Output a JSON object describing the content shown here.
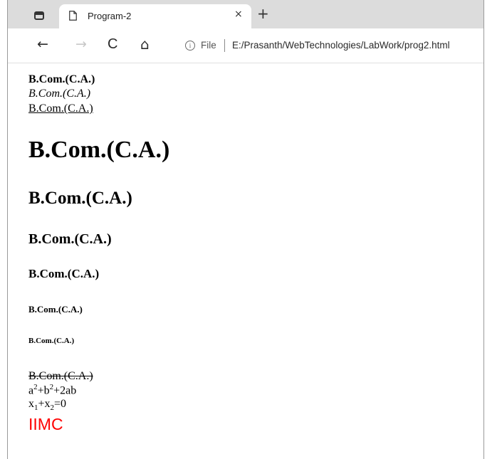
{
  "browser": {
    "tab_title": "Program-2",
    "tab_close": "×",
    "new_tab": "+",
    "back": "←",
    "forward": "→",
    "reload": "C",
    "home": "⌂",
    "info": "i",
    "file_label": "File",
    "url": "E:/Prasanth/WebTechnologies/LabWork/prog2.html"
  },
  "content": {
    "bold_text": "B.Com.(C.A.)",
    "italic_text": "B.Com.(C.A.)",
    "underline_text": "B.Com.(C.A.)",
    "h1": "B.Com.(C.A.)",
    "h2": "B.Com.(C.A.)",
    "h3": "B.Com.(C.A.)",
    "h4": "B.Com.(C.A.)",
    "h5": "B.Com.(C.A.)",
    "h6": "B.Com.(C.A.)",
    "strike_text": "B.Com.(C.A.)",
    "formula1": {
      "a": "a",
      "a_exp": "2",
      "plus_b": "+b",
      "b_exp": "2",
      "rest": "+2ab"
    },
    "formula2": {
      "x1": "x",
      "x1_sub": "1",
      "plus_x": "+x",
      "x2_sub": "2",
      "rest": "=0"
    },
    "iimc_text": "IIMC",
    "iimc_color": "#ff0000"
  }
}
